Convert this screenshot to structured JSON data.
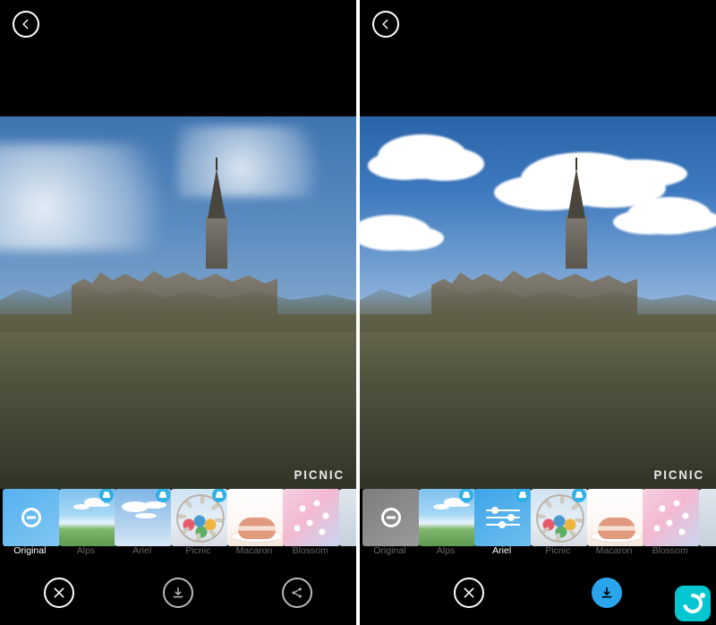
{
  "app_name": "PICNIC",
  "panes": {
    "left": {
      "watermark": "PICNIC",
      "selected_filter": "Original",
      "filters": [
        {
          "id": "original",
          "label": "Original",
          "badge": false,
          "selected": true
        },
        {
          "id": "alps",
          "label": "Alps",
          "badge": true,
          "selected": false
        },
        {
          "id": "ariel",
          "label": "Ariel",
          "badge": true,
          "selected": false
        },
        {
          "id": "picnic",
          "label": "Picnic",
          "badge": true,
          "selected": false
        },
        {
          "id": "macaron",
          "label": "Macaron",
          "badge": false,
          "selected": false
        },
        {
          "id": "blossom",
          "label": "Blossom",
          "badge": false,
          "selected": false
        }
      ],
      "bottom_actions": [
        "close",
        "download",
        "share"
      ]
    },
    "right": {
      "watermark": "PICNIC",
      "selected_filter": "Ariel",
      "filters": [
        {
          "id": "original",
          "label": "Original",
          "badge": false,
          "selected": false
        },
        {
          "id": "alps",
          "label": "Alps",
          "badge": true,
          "selected": false
        },
        {
          "id": "ariel",
          "label": "Ariel",
          "badge": true,
          "selected": true
        },
        {
          "id": "picnic",
          "label": "Picnic",
          "badge": true,
          "selected": false
        },
        {
          "id": "macaron",
          "label": "Macaron",
          "badge": false,
          "selected": false
        },
        {
          "id": "blossom",
          "label": "Blossom",
          "badge": false,
          "selected": false
        }
      ],
      "bottom_actions": [
        "close",
        "download"
      ]
    }
  }
}
